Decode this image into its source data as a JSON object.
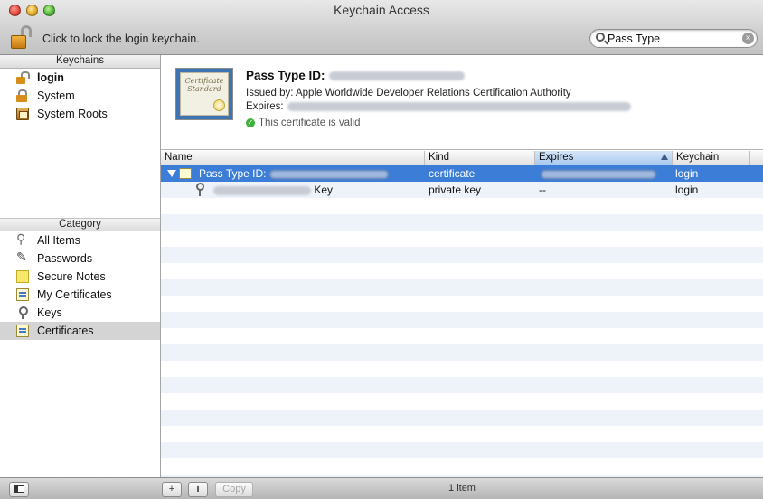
{
  "window": {
    "title": "Keychain Access"
  },
  "toolbar": {
    "lock_label": "Click to lock the login keychain.",
    "search_value": "Pass Type",
    "search_clear": "×"
  },
  "sidebar": {
    "keychains_header": "Keychains",
    "keychains": [
      {
        "label": "login",
        "icon": "lock-open-icon"
      },
      {
        "label": "System",
        "icon": "lock-icon"
      },
      {
        "label": "System Roots",
        "icon": "cabinet-icon"
      }
    ],
    "category_header": "Category",
    "categories": [
      {
        "label": "All Items",
        "icon": "all-items-icon"
      },
      {
        "label": "Passwords",
        "icon": "pen-icon"
      },
      {
        "label": "Secure Notes",
        "icon": "note-icon"
      },
      {
        "label": "My Certificates",
        "icon": "certificate-icon"
      },
      {
        "label": "Keys",
        "icon": "key-icon"
      },
      {
        "label": "Certificates",
        "icon": "certificate-icon",
        "selected": true
      }
    ]
  },
  "detail": {
    "cert_image_text": "Certificate Standard",
    "title": "Pass Type ID:",
    "issued_by": "Issued by: Apple Worldwide Developer Relations Certification Authority",
    "expires_label": "Expires:",
    "valid_text": "This certificate is valid",
    "valid_mark": "✓"
  },
  "table": {
    "columns": [
      "Name",
      "Kind",
      "Expires",
      "Keychain"
    ],
    "sorted_column": "Expires",
    "rows": [
      {
        "name": "Pass Type ID:",
        "kind": "certificate",
        "expires": "",
        "keychain": "login",
        "selected": true
      },
      {
        "name": "Key",
        "kind": "private key",
        "expires": "--",
        "keychain": "login",
        "selected": false
      }
    ]
  },
  "bottom": {
    "add_label": "+",
    "info_label": "i",
    "copy_label": "Copy",
    "status": "1 item"
  },
  "colors": {
    "selection": "#3c7dd8",
    "sidebar_selection": "#d4d4d4",
    "sorted_header": "#a9c9ef",
    "valid_green": "#3bb33b"
  }
}
